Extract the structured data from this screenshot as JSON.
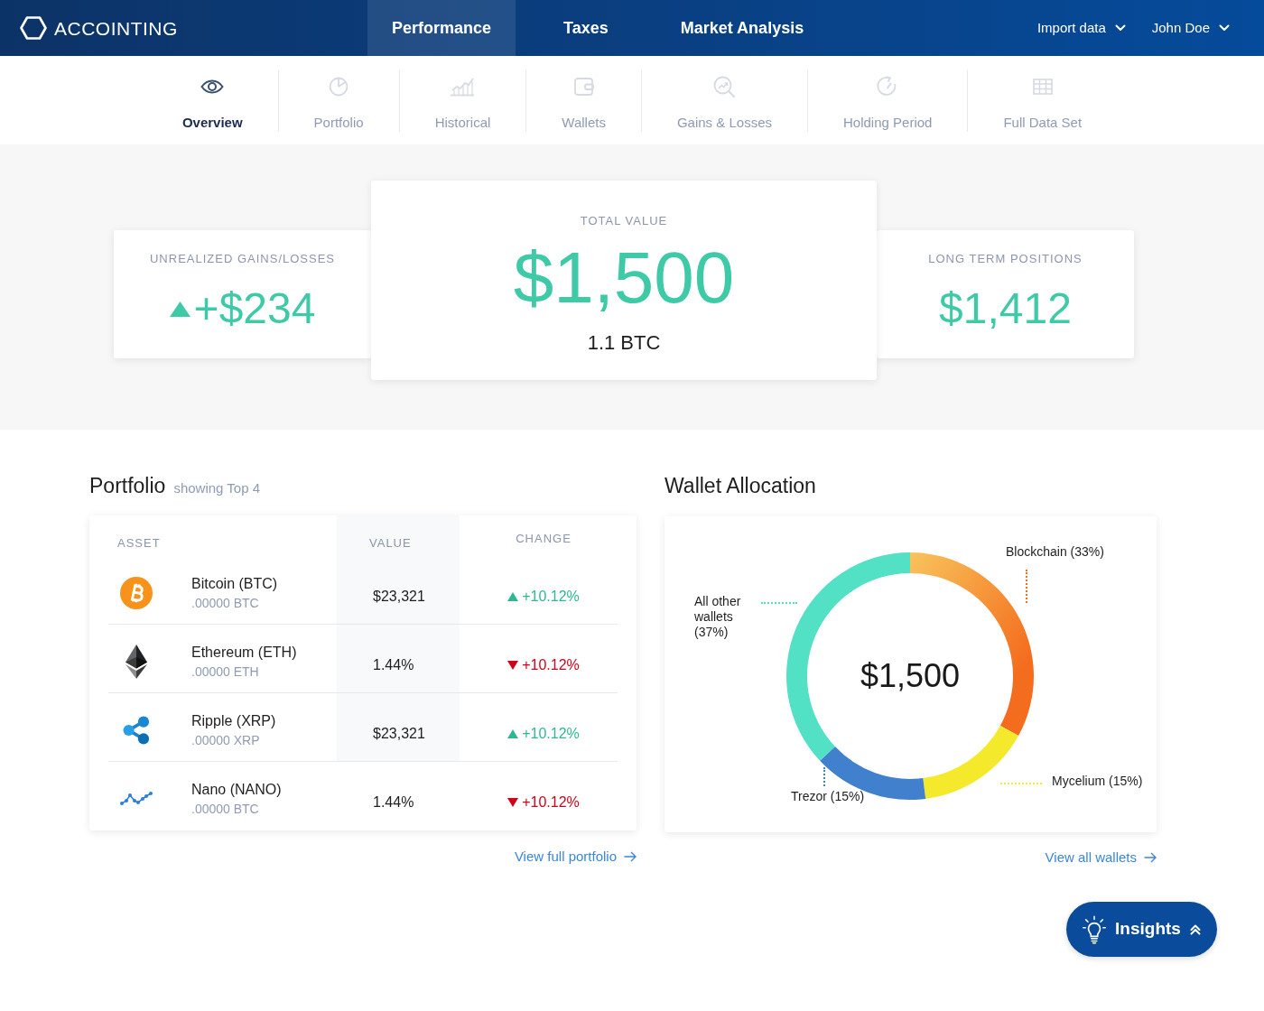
{
  "brand": {
    "logo_text": "ACCOINTING"
  },
  "main_nav": {
    "tabs": [
      {
        "label": "Performance",
        "selected": true
      },
      {
        "label": "Taxes",
        "selected": false
      },
      {
        "label": "Market Analysis",
        "selected": false
      }
    ],
    "menus": [
      {
        "label": "Import data"
      },
      {
        "label": "John Doe"
      }
    ]
  },
  "sub_nav": {
    "items": [
      {
        "label": "Overview",
        "selected": true
      },
      {
        "label": "Portfolio",
        "selected": false
      },
      {
        "label": "Historical",
        "selected": false
      },
      {
        "label": "Wallets",
        "selected": false
      },
      {
        "label": "Gains & Losses",
        "selected": false
      },
      {
        "label": "Holding Period",
        "selected": false
      },
      {
        "label": "Full Data Set",
        "selected": false
      }
    ]
  },
  "summary": {
    "cards": [
      {
        "kind": "side",
        "label": "UNREALIZED GAINS/LOSSES",
        "value": "+$234",
        "rising": true
      },
      {
        "kind": "main",
        "label": "TOTAL VALUE",
        "value": "$1,500",
        "sub_value": "1.1 BTC"
      },
      {
        "kind": "side",
        "label": "LONG TERM POSITIONS",
        "value": "$1,412"
      }
    ]
  },
  "portfolio": {
    "title": "Portfolio",
    "subtitle": "showing Top 4",
    "columns": [
      "ASSET",
      "VALUE",
      "CHANGE"
    ],
    "rows": [
      {
        "name": "Bitcoin (BTC)",
        "amount": ".00000 BTC",
        "value": "$23,321",
        "change": "+10.12%",
        "rising": true
      },
      {
        "name": "Ethereum (ETH)",
        "amount": ".00000 ETH",
        "value": "1.44%",
        "change": "+10.12%",
        "rising": false
      },
      {
        "name": "Ripple (XRP)",
        "amount": ".00000 XRP",
        "value": "$23,321",
        "change": "+10.12%",
        "rising": true
      },
      {
        "name": "Nano (NANO)",
        "amount": ".00000 BTC",
        "value": "1.44%",
        "change": "+10.12%",
        "rising": false
      }
    ],
    "link": "View full portfolio"
  },
  "wallets": {
    "title": "Wallet Allocation",
    "center_value": "$1,500",
    "chart_data": {
      "type": "donut",
      "categories": [
        "Blockchain (33%)",
        "Mycelium (15%)",
        "Trezor (15%)",
        "All other wallets (37%)"
      ],
      "values": [
        33,
        15,
        15,
        37
      ]
    },
    "slice_styles": [
      {
        "color": "#f46d1e",
        "gradient": true
      },
      {
        "color": "#f5e92b",
        "gradient": false
      },
      {
        "color": "#4180cc",
        "gradient": false
      },
      {
        "color": "#52e1c4",
        "gradient": false
      }
    ],
    "link": "View all wallets"
  },
  "insights_button": {
    "label": "Insights"
  }
}
